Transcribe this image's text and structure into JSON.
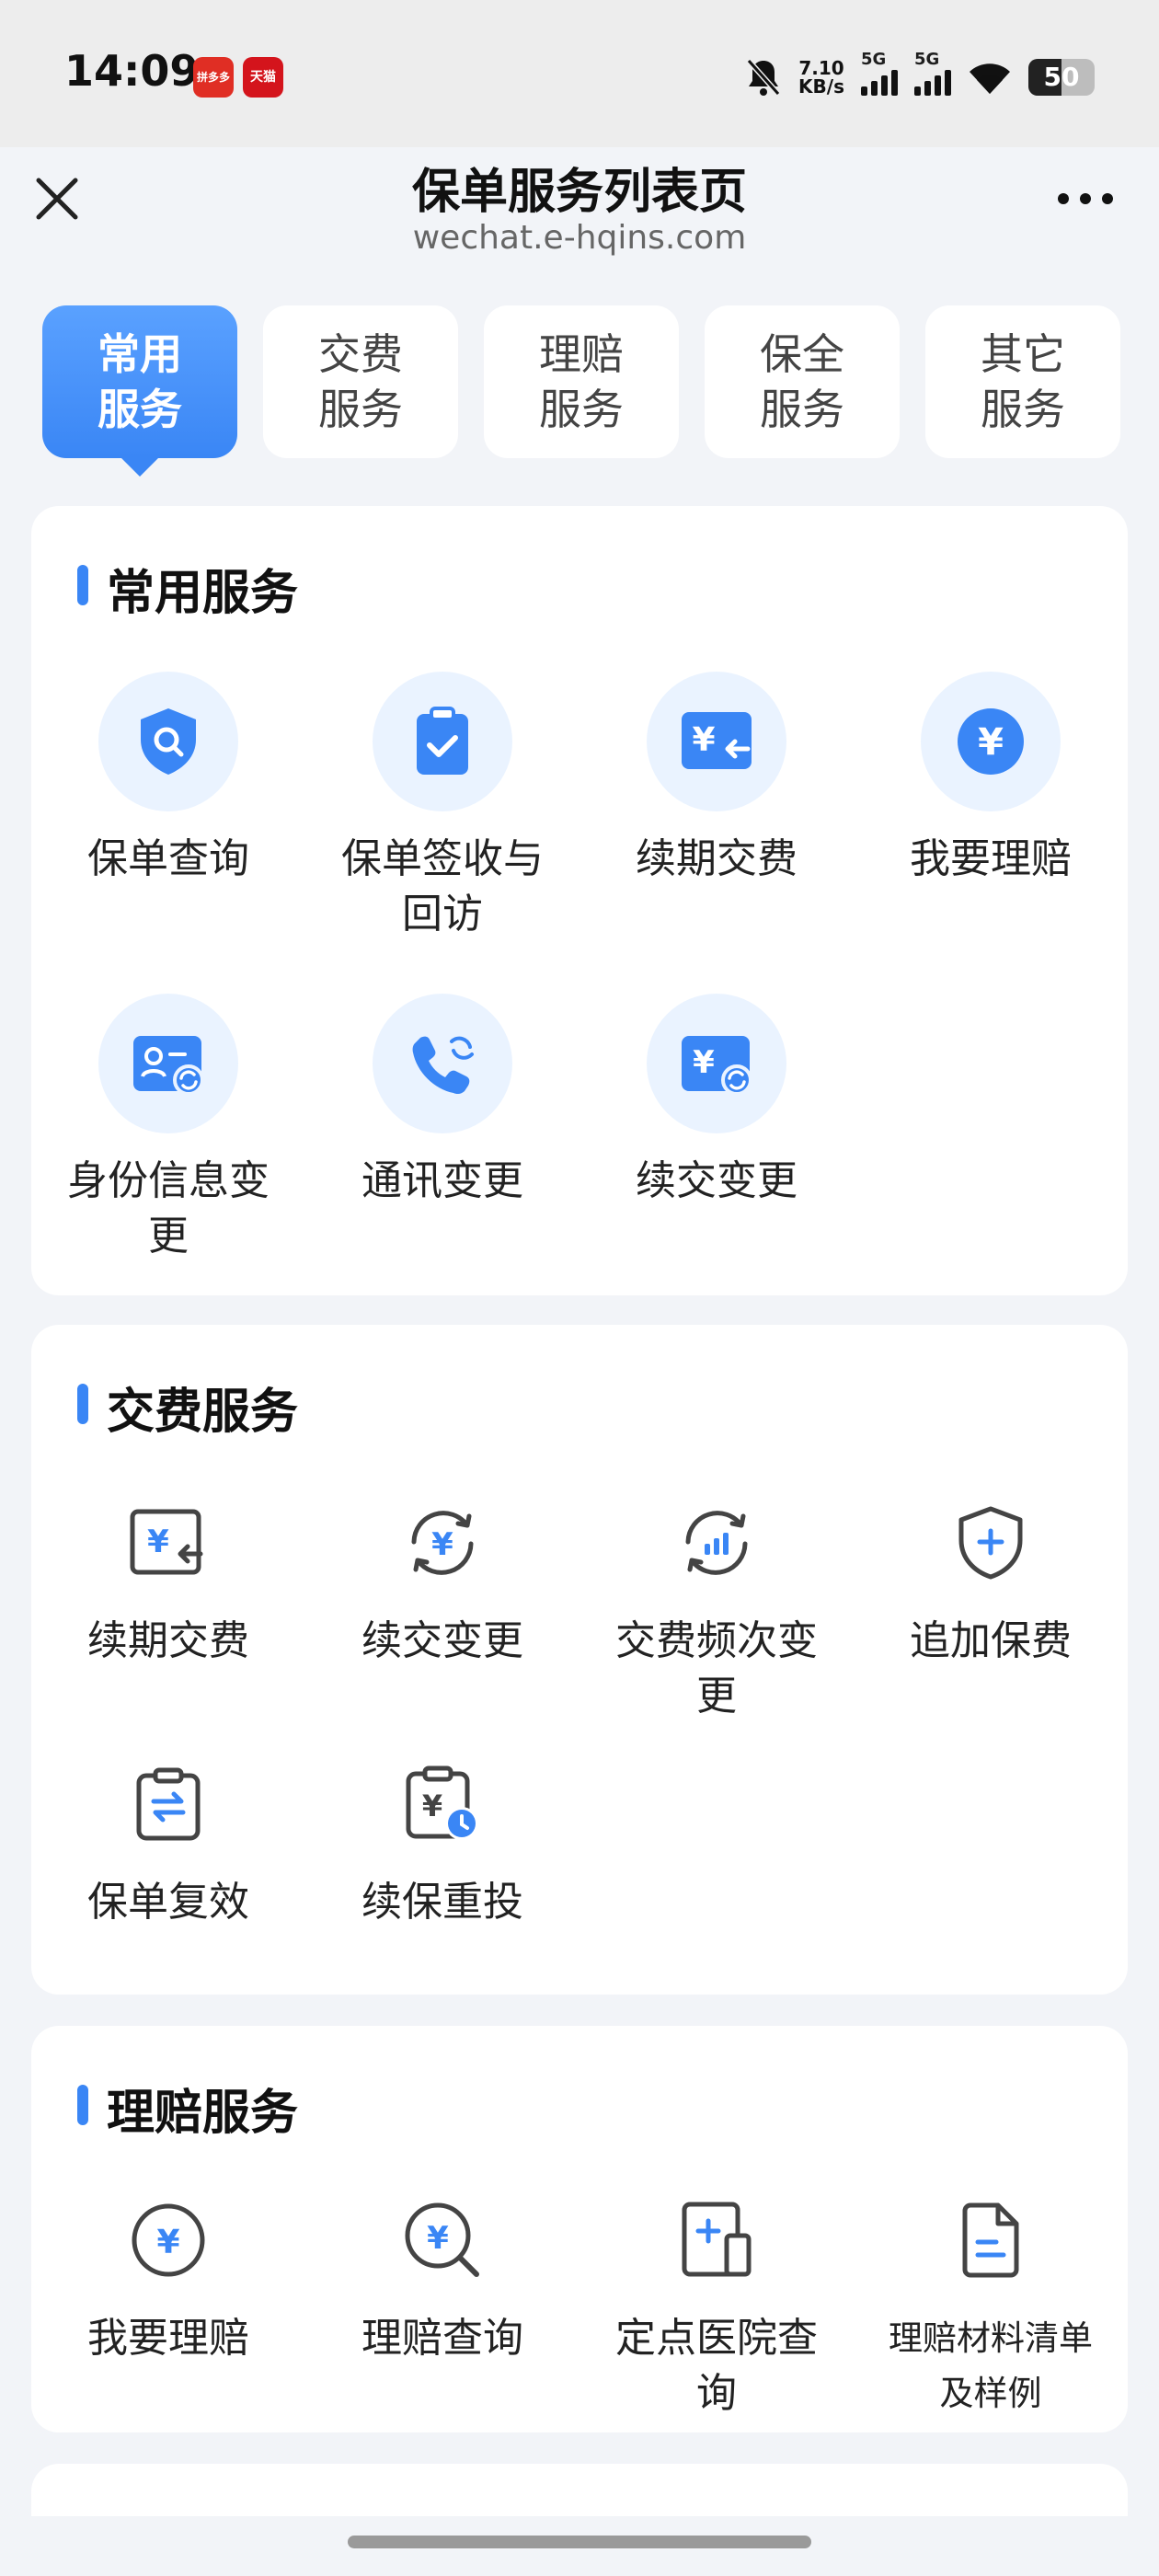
{
  "status_bar": {
    "time": "14:09",
    "app_badges": [
      "拼多多",
      "天猫"
    ],
    "net_speed": "7.10",
    "net_speed_unit": "KB/s",
    "signal_1": "5G",
    "signal_2": "5G",
    "battery": "50"
  },
  "header": {
    "title": "保单服务列表页",
    "url": "wechat.e-hqins.com"
  },
  "tabs": [
    {
      "label": "常用\n服务",
      "active": true
    },
    {
      "label": "交费\n服务",
      "active": false
    },
    {
      "label": "理赔\n服务",
      "active": false
    },
    {
      "label": "保全\n服务",
      "active": false
    },
    {
      "label": "其它\n服务",
      "active": false
    }
  ],
  "sections": {
    "common": {
      "title": "常用服务",
      "items": [
        {
          "label": "保单查询",
          "icon": "shield-search-icon"
        },
        {
          "label": "保单签收与回访",
          "icon": "clipboard-check-icon"
        },
        {
          "label": "续期交费",
          "icon": "yuan-return-icon"
        },
        {
          "label": "我要理赔",
          "icon": "yuan-circle-icon"
        },
        {
          "label": "身份信息变更",
          "icon": "id-card-refresh-icon"
        },
        {
          "label": "通讯变更",
          "icon": "phone-refresh-icon"
        },
        {
          "label": "续交变更",
          "icon": "yuan-refresh-icon"
        }
      ]
    },
    "payment": {
      "title": "交费服务",
      "items": [
        {
          "label": "续期交费",
          "icon": "yuan-return-icon"
        },
        {
          "label": "续交变更",
          "icon": "yuan-cycle-icon"
        },
        {
          "label": "交费频次变更",
          "icon": "chart-cycle-icon"
        },
        {
          "label": "追加保费",
          "icon": "shield-plus-icon"
        },
        {
          "label": "保单复效",
          "icon": "clipboard-swap-icon"
        },
        {
          "label": "续保重投",
          "icon": "clipboard-clock-icon"
        }
      ]
    },
    "claims": {
      "title": "理赔服务",
      "items": [
        {
          "label": "我要理赔",
          "icon": "yuan-circle-outline-icon"
        },
        {
          "label": "理赔查询",
          "icon": "yuan-search-icon"
        },
        {
          "label": "定点医院查询",
          "icon": "hospital-doc-icon"
        },
        {
          "label": "理赔材料清单及样例",
          "icon": "document-list-icon"
        }
      ]
    }
  },
  "colors": {
    "accent": "#3a86f5",
    "icon_bg": "#eaf3ff",
    "page_bg": "#f2f4f8"
  }
}
